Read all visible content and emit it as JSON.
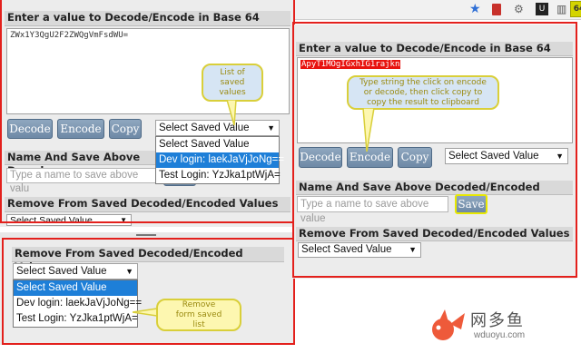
{
  "browser_bar": {
    "star_icon": "star-icon",
    "ext_badge": "64"
  },
  "left_panel": {
    "title": "Enter a value to Decode/Encode in Base 64",
    "textarea_value": "ZWx1Y3QgU2F2ZWQgVmFsdWU=",
    "buttons": {
      "decode": "Decode",
      "encode": "Encode",
      "copy": "Copy"
    },
    "select_value": "Select Saved Value",
    "dropdown_options": [
      "Select Saved Value",
      "Dev login: laekJaVjJoNg==",
      "Test Login: YzJka1ptWjA="
    ],
    "name_save_label": "Name And Save Above Decode",
    "name_input_placeholder": "Type a name to save above valu",
    "remove_label": "Remove From Saved Decoded/Encoded Values",
    "remove_select_value": "Select Saved Value",
    "note": "List of saved values"
  },
  "bottom_panel": {
    "remove_label": "Remove From Saved Decoded/Encoded Values",
    "select_value": "Select Saved Value",
    "dropdown_options": [
      "Select Saved Value",
      "Dev login: laekJaVjJoNg==",
      "Test Login: YzJka1ptWjA="
    ],
    "note": "Remove form saved list"
  },
  "right_panel": {
    "title": "Enter a value to Decode/Encode in Base 64",
    "textarea_value": "ApyT1MOgIGxhIG1rajkn",
    "buttons": {
      "decode": "Decode",
      "encode": "Encode",
      "copy": "Copy"
    },
    "select_value": "Select Saved Value",
    "name_save_label": "Name And Save Above Decoded/Encoded Value:",
    "name_input_placeholder": "Type a name to save above value",
    "save_button": "Save",
    "remove_label": "Remove From Saved Decoded/Encoded Values",
    "remove_select_value": "Select Saved Value",
    "note": "Type string the click on encode or decode, then click copy to copy the result to clipboard"
  },
  "watermark": {
    "brand": "网多鱼",
    "url": "wduoyu.com"
  },
  "colors": {
    "frame_red": "#e3201c",
    "note_yellow": "#fdf7b0",
    "button_blue": "#7b96b3",
    "select_highlight": "#1e7fd8",
    "ext_icon": "#d4d400"
  }
}
